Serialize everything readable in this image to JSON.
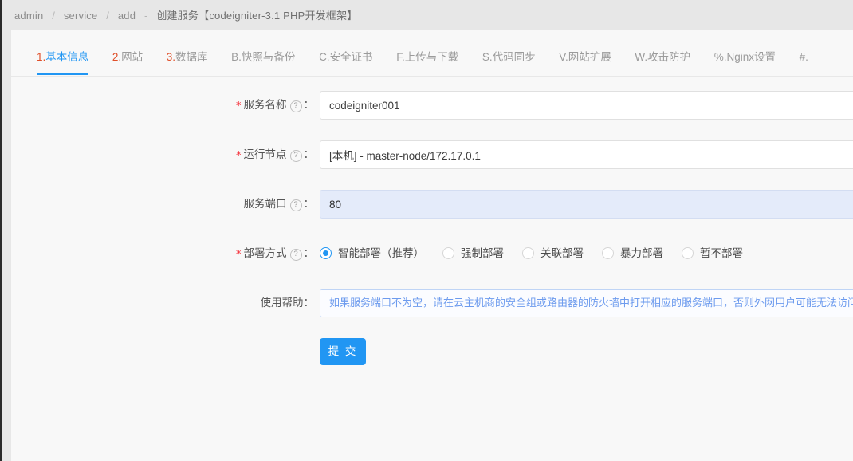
{
  "breadcrumb": {
    "items": [
      "admin",
      "service",
      "add"
    ],
    "separator": "/",
    "dash": "-",
    "title": "创建服务【codeigniter-3.1 PHP开发框架】"
  },
  "tabs": [
    {
      "prefix": "1.",
      "label": "基本信息",
      "active": true,
      "hot": true
    },
    {
      "prefix": "2.",
      "label": "网站",
      "active": false,
      "hot": true
    },
    {
      "prefix": "3.",
      "label": "数据库",
      "active": false,
      "hot": true
    },
    {
      "prefix": "B.",
      "label": "快照与备份",
      "active": false,
      "hot": false
    },
    {
      "prefix": "C.",
      "label": "安全证书",
      "active": false,
      "hot": false
    },
    {
      "prefix": "F.",
      "label": "上传与下载",
      "active": false,
      "hot": false
    },
    {
      "prefix": "S.",
      "label": "代码同步",
      "active": false,
      "hot": false
    },
    {
      "prefix": "V.",
      "label": "网站扩展",
      "active": false,
      "hot": false
    },
    {
      "prefix": "W.",
      "label": "攻击防护",
      "active": false,
      "hot": false
    },
    {
      "prefix": "%.",
      "label": "Nginx设置",
      "active": false,
      "hot": false
    },
    {
      "prefix": "#.",
      "label": "",
      "active": false,
      "hot": false
    }
  ],
  "form": {
    "service_name": {
      "label": "服务名称",
      "required": true,
      "help_icon": "question-circle-icon",
      "colon": "：",
      "value": "codeigniter001"
    },
    "run_node": {
      "label": "运行节点",
      "required": true,
      "help_icon": "question-circle-icon",
      "colon": "：",
      "value": "[本机] - master-node/172.17.0.1"
    },
    "service_port": {
      "label": "服务端口",
      "required": false,
      "help_icon": "question-circle-icon",
      "colon": "：",
      "value": "80"
    },
    "deploy_mode": {
      "label": "部署方式",
      "required": true,
      "help_icon": "question-circle-icon",
      "colon": "：",
      "selected": "智能部署（推荐）",
      "options": [
        "智能部署（推荐）",
        "强制部署",
        "关联部署",
        "暴力部署",
        "暂不部署"
      ]
    },
    "usage_help": {
      "label": "使用帮助",
      "required": false,
      "colon": "：",
      "text": "如果服务端口不为空，请在云主机商的安全组或路由器的防火墙中打开相应的服务端口，否则外网用户可能无法访问"
    },
    "submit": {
      "label": "提 交"
    }
  },
  "colors": {
    "accent": "#2196f3",
    "tab_prefix_hot": "#e0502a",
    "required_star": "#f5222d",
    "help_text": "#6d9bee",
    "autofill_bg": "#e4ebfa",
    "page_bg": "#e7e7e7",
    "card_bg": "#f8f8f8"
  }
}
